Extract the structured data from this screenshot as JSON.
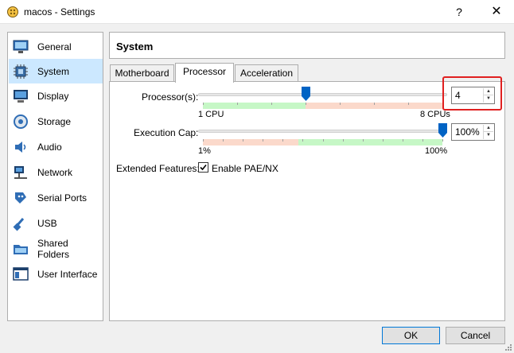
{
  "window": {
    "title": "macos - Settings",
    "help_label": "?",
    "close_label": "✕"
  },
  "sidebar": {
    "items": [
      {
        "label": "General",
        "icon": "general-monitor-icon"
      },
      {
        "label": "System",
        "icon": "chip-icon",
        "selected": true
      },
      {
        "label": "Display",
        "icon": "display-monitor-icon"
      },
      {
        "label": "Storage",
        "icon": "disk-icon"
      },
      {
        "label": "Audio",
        "icon": "speaker-icon"
      },
      {
        "label": "Network",
        "icon": "network-icon"
      },
      {
        "label": "Serial Ports",
        "icon": "serial-port-icon"
      },
      {
        "label": "USB",
        "icon": "usb-icon"
      },
      {
        "label": "Shared Folders",
        "icon": "folder-icon"
      },
      {
        "label": "User Interface",
        "icon": "user-interface-icon"
      }
    ]
  },
  "header": {
    "title": "System"
  },
  "tabs": [
    {
      "label": "Motherboard"
    },
    {
      "label": "Processor",
      "active": true
    },
    {
      "label": "Acceleration"
    }
  ],
  "processor": {
    "label": "Processor(s):",
    "value": "4",
    "min_label": "1 CPU",
    "max_label": "8 CPUs",
    "min": 1,
    "max": 8,
    "current": 4
  },
  "exec_cap": {
    "label": "Execution Cap:",
    "value": "100%",
    "min_label": "1%",
    "max_label": "100%",
    "min": 1,
    "max": 100,
    "current": 100
  },
  "extended": {
    "label": "Extended Features:",
    "checkbox_label": "Enable PAE/NX",
    "checked": true
  },
  "buttons": {
    "ok": "OK",
    "cancel": "Cancel"
  },
  "colors": {
    "selection": "#cce8ff",
    "good": "#c6f7c6",
    "warn": "#fbd9cb",
    "accent": "#0078d7",
    "highlight": "#e02020"
  }
}
